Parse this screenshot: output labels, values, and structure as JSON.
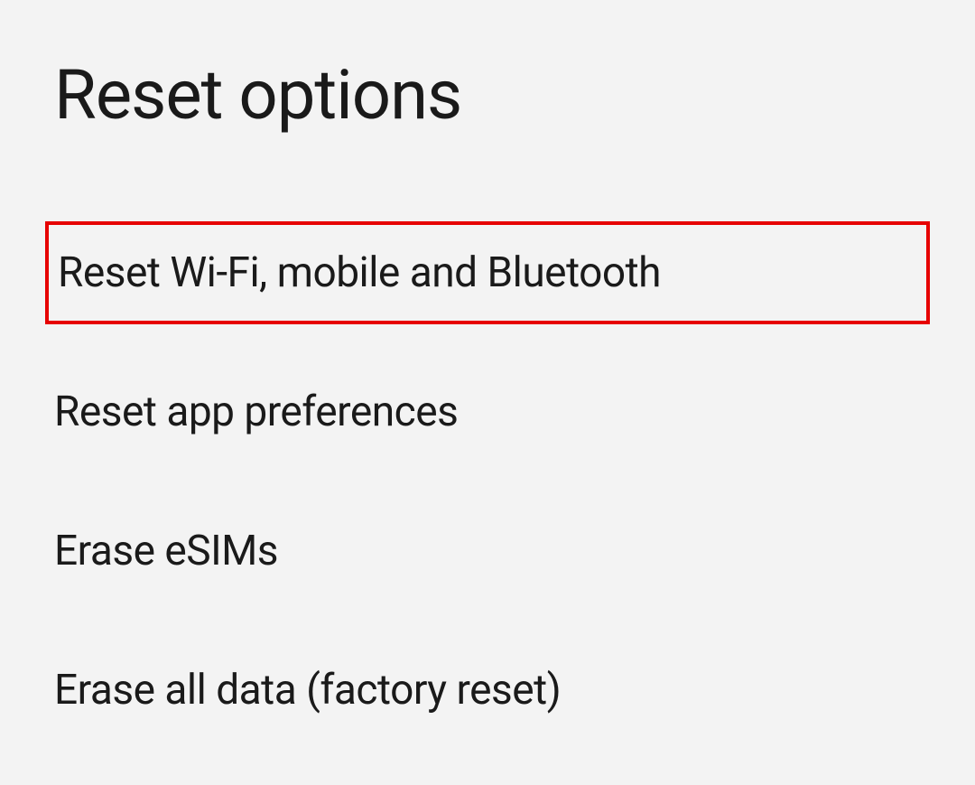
{
  "header": {
    "title": "Reset options"
  },
  "options": [
    {
      "label": "Reset Wi-Fi, mobile and Bluetooth",
      "highlighted": true
    },
    {
      "label": "Reset app preferences",
      "highlighted": false
    },
    {
      "label": "Erase eSIMs",
      "highlighted": false
    },
    {
      "label": "Erase all data (factory reset)",
      "highlighted": false
    }
  ],
  "colors": {
    "highlight": "#e60000",
    "background": "#f3f3f3",
    "text": "#1a1a1a"
  }
}
